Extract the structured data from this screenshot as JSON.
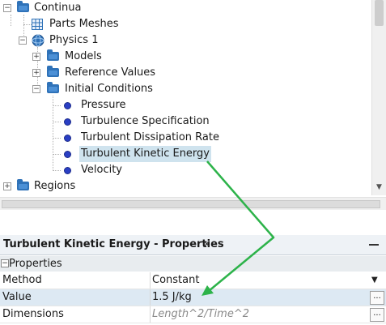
{
  "tree": {
    "items": [
      {
        "label": "Continua"
      },
      {
        "label": "Parts Meshes"
      },
      {
        "label": "Physics 1"
      },
      {
        "label": "Models"
      },
      {
        "label": "Reference Values"
      },
      {
        "label": "Initial Conditions"
      },
      {
        "label": "Pressure"
      },
      {
        "label": "Turbulence Specification"
      },
      {
        "label": "Turbulent Dissipation Rate"
      },
      {
        "label": "Turbulent Kinetic Energy"
      },
      {
        "label": "Velocity"
      },
      {
        "label": "Regions"
      }
    ],
    "selected": "Turbulent Kinetic Energy"
  },
  "properties_panel": {
    "tab_title": "Turbulent Kinetic Energy - Properties",
    "close_glyph": "×",
    "section_label": "Properties",
    "section_toggle": "−",
    "rows": [
      {
        "name": "Method",
        "value": "Constant"
      },
      {
        "name": "Value",
        "value": "1.5 J/kg"
      },
      {
        "name": "Dimensions",
        "value": "Length^2/Time^2"
      }
    ],
    "ellipsis": "..."
  },
  "colors": {
    "selection": "#cfe3ee",
    "annotation_arrow": "#2db34a",
    "folder": "#2f72b8",
    "leaf_dot": "#2a3fc4"
  }
}
